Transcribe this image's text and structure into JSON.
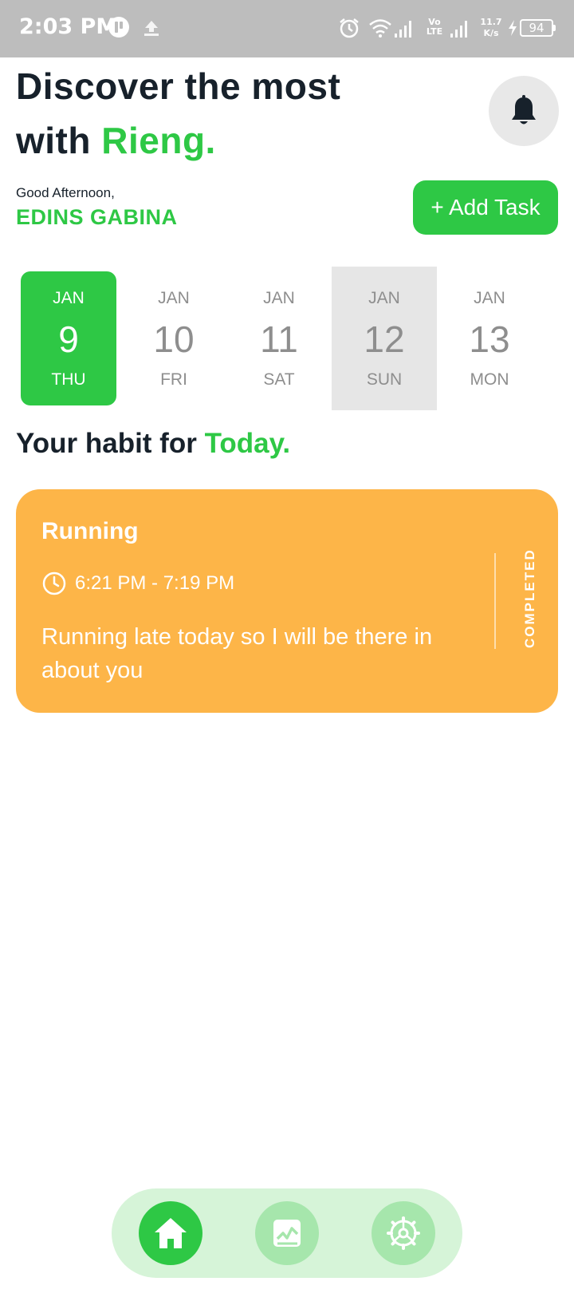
{
  "status_bar": {
    "time": "2:03 PM",
    "network_type": "Vo LTE",
    "speed_value": "11.7",
    "speed_unit": "K/s",
    "battery": "94"
  },
  "header": {
    "headline_line1": "Discover the most",
    "headline_with": "with ",
    "headline_brand": "Rieng.",
    "greeting": "Good Afternoon,",
    "username": "EDINS GABINA",
    "add_task_label": "+ Add Task"
  },
  "calendar": {
    "dates": [
      {
        "month": "JAN",
        "day": "9",
        "weekday": "THU"
      },
      {
        "month": "JAN",
        "day": "10",
        "weekday": "FRI"
      },
      {
        "month": "JAN",
        "day": "11",
        "weekday": "SAT"
      },
      {
        "month": "JAN",
        "day": "12",
        "weekday": "SUN"
      },
      {
        "month": "JAN",
        "day": "13",
        "weekday": "MON"
      }
    ]
  },
  "habits_section": {
    "title_prefix": "Your habit for ",
    "title_accent": "Today."
  },
  "habit_card": {
    "title": "Running",
    "time": "6:21 PM - 7:19 PM",
    "note": "Running late today so I will be there in about you",
    "status": "COMPLETED"
  },
  "colors": {
    "accent_green": "#2ec845",
    "card_orange": "#fdb548",
    "nav_background": "#d6f4d8"
  },
  "icons": [
    "bell-icon",
    "clock-icon",
    "home-icon",
    "chart-icon",
    "settings-icon"
  ]
}
